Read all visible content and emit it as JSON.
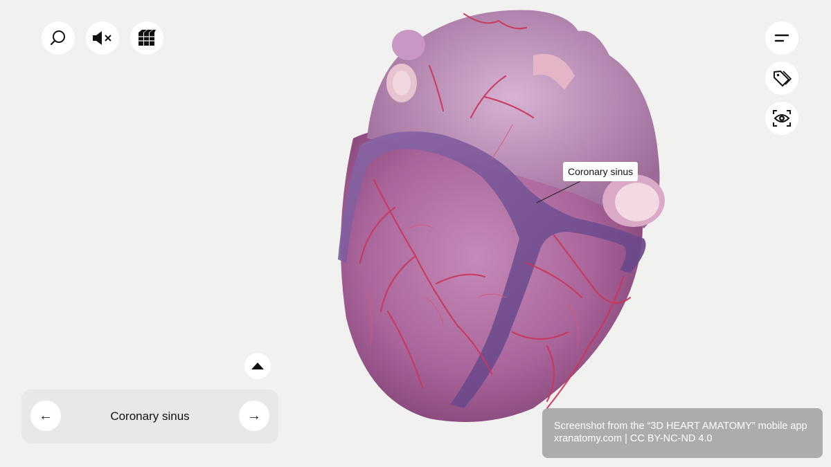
{
  "toolbar_left": {
    "search_icon": "search-icon",
    "sound_icon": "mute-icon",
    "layers_icon": "layers-icon"
  },
  "toolbar_right": {
    "menu_icon": "menu-icon",
    "tags_icon": "tag-icon",
    "view_icon": "eye-view-icon"
  },
  "model": {
    "label": "Coronary sinus"
  },
  "navigator": {
    "prev_arrow": "←",
    "title": "Coronary sinus",
    "next_arrow": "→",
    "collapse_icon": "triangle-up-icon"
  },
  "credit": {
    "line1": "Screenshot from the “3D HEART AMATOMY” mobile app",
    "line2": "xranatomy.com | CC BY-NC-ND 4.0"
  },
  "colors": {
    "background": "#f1f1f0",
    "heart": "#b06a9e",
    "vessels": "#c9375a",
    "sinus": "#7a4f8e"
  }
}
